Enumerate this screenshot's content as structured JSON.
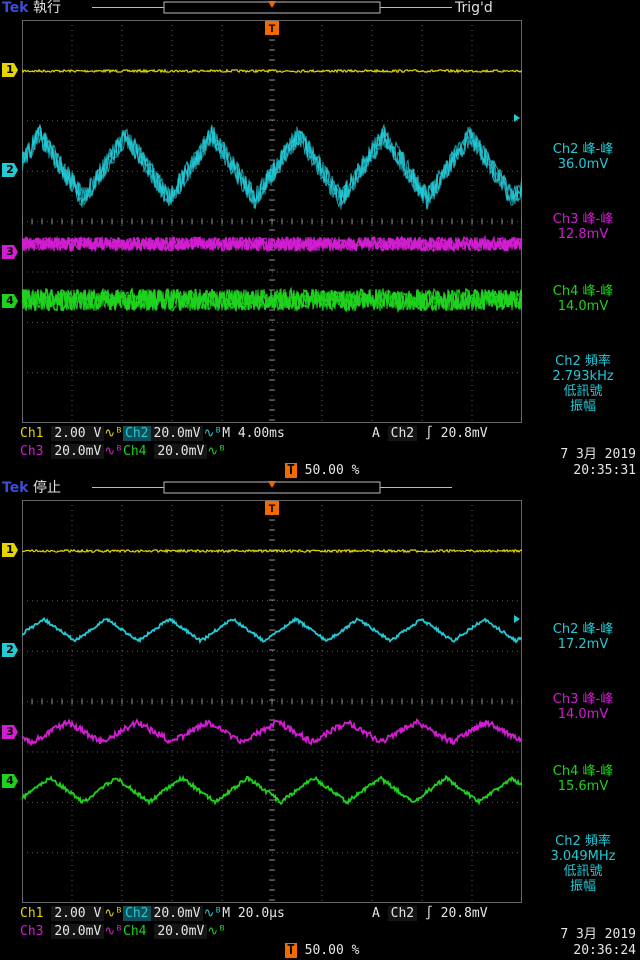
{
  "screens": [
    {
      "brand": "Tek",
      "state": "執行",
      "trig": "Trig'd",
      "meas": [
        {
          "title": "Ch2 峰-峰",
          "value": "36.0mV",
          "color": "#24c9d6"
        },
        {
          "title": "Ch3 峰-峰",
          "value": "12.8mV",
          "color": "#d21dd2"
        },
        {
          "title": "Ch4 峰-峰",
          "value": "14.0mV",
          "color": "#1fd21f"
        },
        {
          "title": "Ch2 頻率",
          "value": "2.793kHz",
          "note1": "低訊號",
          "note2": "振幅",
          "color": "#24c9d6"
        }
      ],
      "ch1": "Ch1",
      "ch1_val": "2.00 V",
      "ch2": "Ch2",
      "ch2_val": "20.0mV",
      "ch3": "Ch3",
      "ch3_val": "20.0mV",
      "ch4": "Ch4",
      "ch4_val": "20.0mV",
      "timebase": "M 4.00ms",
      "trig_mode": "A",
      "trig_src": "Ch2",
      "trig_level": "20.8mV",
      "trig_pos": "50.00 %",
      "date": "7 3月  2019",
      "time": "20:35:31",
      "wave2": {
        "amp": 32,
        "period": 86,
        "noise": 11,
        "phase": -25
      }
    },
    {
      "brand": "Tek",
      "state": "停止",
      "trig": "",
      "meas": [
        {
          "title": "Ch2 峰-峰",
          "value": "17.2mV",
          "color": "#24c9d6"
        },
        {
          "title": "Ch3 峰-峰",
          "value": "14.0mV",
          "color": "#d21dd2"
        },
        {
          "title": "Ch4 峰-峰",
          "value": "15.6mV",
          "color": "#1fd21f"
        },
        {
          "title": "Ch2 頻率",
          "value": "3.049MHz",
          "note1": "低訊號",
          "note2": "振幅",
          "color": "#24c9d6"
        }
      ],
      "ch1": "Ch1",
      "ch1_val": "2.00 V",
      "ch2": "Ch2",
      "ch2_val": "20.0mV",
      "ch3": "Ch3",
      "ch3_val": "20.0mV",
      "ch4": "Ch4",
      "ch4_val": "20.0mV",
      "timebase": "M 20.0µs",
      "trig_mode": "A",
      "trig_src": "Ch2",
      "trig_level": "20.8mV",
      "trig_pos": "50.00 %",
      "date": "7 3月  2019",
      "time": "20:36:24",
      "wave2": {
        "amp": 11,
        "period": 63,
        "noise": 3,
        "phase": -10
      }
    }
  ],
  "colors": {
    "ch1": "#e6d400",
    "ch2": "#24c9d6",
    "ch3": "#d21dd2",
    "ch4": "#1fd21f",
    "trigger": "#f06a00"
  },
  "icons": {
    "trigger_marker": "T-marker-icon",
    "coupling": "bandwidth-limit-icon",
    "slope": "rising-edge-icon"
  }
}
